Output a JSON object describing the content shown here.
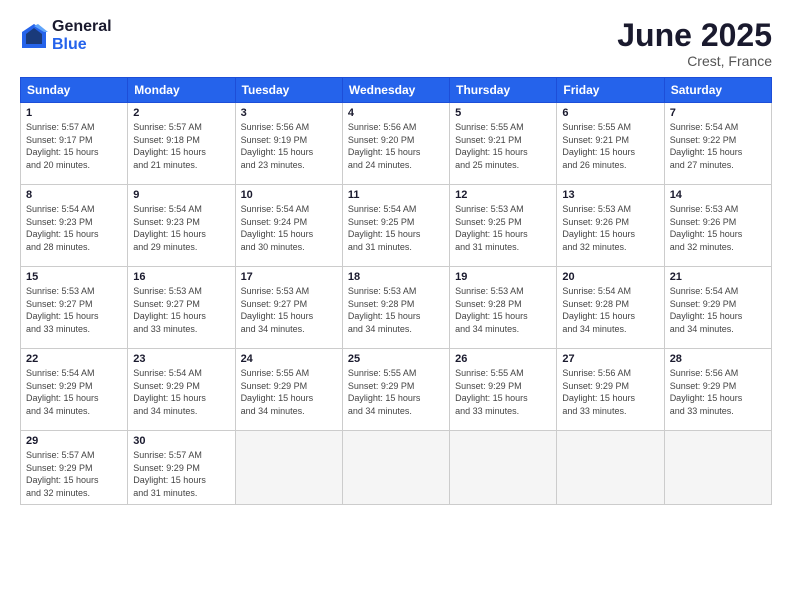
{
  "logo": {
    "general": "General",
    "blue": "Blue"
  },
  "title": "June 2025",
  "location": "Crest, France",
  "headers": [
    "Sunday",
    "Monday",
    "Tuesday",
    "Wednesday",
    "Thursday",
    "Friday",
    "Saturday"
  ],
  "weeks": [
    [
      {
        "day": "1",
        "info": "Sunrise: 5:57 AM\nSunset: 9:17 PM\nDaylight: 15 hours\nand 20 minutes."
      },
      {
        "day": "2",
        "info": "Sunrise: 5:57 AM\nSunset: 9:18 PM\nDaylight: 15 hours\nand 21 minutes."
      },
      {
        "day": "3",
        "info": "Sunrise: 5:56 AM\nSunset: 9:19 PM\nDaylight: 15 hours\nand 23 minutes."
      },
      {
        "day": "4",
        "info": "Sunrise: 5:56 AM\nSunset: 9:20 PM\nDaylight: 15 hours\nand 24 minutes."
      },
      {
        "day": "5",
        "info": "Sunrise: 5:55 AM\nSunset: 9:21 PM\nDaylight: 15 hours\nand 25 minutes."
      },
      {
        "day": "6",
        "info": "Sunrise: 5:55 AM\nSunset: 9:21 PM\nDaylight: 15 hours\nand 26 minutes."
      },
      {
        "day": "7",
        "info": "Sunrise: 5:54 AM\nSunset: 9:22 PM\nDaylight: 15 hours\nand 27 minutes."
      }
    ],
    [
      {
        "day": "8",
        "info": "Sunrise: 5:54 AM\nSunset: 9:23 PM\nDaylight: 15 hours\nand 28 minutes."
      },
      {
        "day": "9",
        "info": "Sunrise: 5:54 AM\nSunset: 9:23 PM\nDaylight: 15 hours\nand 29 minutes."
      },
      {
        "day": "10",
        "info": "Sunrise: 5:54 AM\nSunset: 9:24 PM\nDaylight: 15 hours\nand 30 minutes."
      },
      {
        "day": "11",
        "info": "Sunrise: 5:54 AM\nSunset: 9:25 PM\nDaylight: 15 hours\nand 31 minutes."
      },
      {
        "day": "12",
        "info": "Sunrise: 5:53 AM\nSunset: 9:25 PM\nDaylight: 15 hours\nand 31 minutes."
      },
      {
        "day": "13",
        "info": "Sunrise: 5:53 AM\nSunset: 9:26 PM\nDaylight: 15 hours\nand 32 minutes."
      },
      {
        "day": "14",
        "info": "Sunrise: 5:53 AM\nSunset: 9:26 PM\nDaylight: 15 hours\nand 32 minutes."
      }
    ],
    [
      {
        "day": "15",
        "info": "Sunrise: 5:53 AM\nSunset: 9:27 PM\nDaylight: 15 hours\nand 33 minutes."
      },
      {
        "day": "16",
        "info": "Sunrise: 5:53 AM\nSunset: 9:27 PM\nDaylight: 15 hours\nand 33 minutes."
      },
      {
        "day": "17",
        "info": "Sunrise: 5:53 AM\nSunset: 9:27 PM\nDaylight: 15 hours\nand 34 minutes."
      },
      {
        "day": "18",
        "info": "Sunrise: 5:53 AM\nSunset: 9:28 PM\nDaylight: 15 hours\nand 34 minutes."
      },
      {
        "day": "19",
        "info": "Sunrise: 5:53 AM\nSunset: 9:28 PM\nDaylight: 15 hours\nand 34 minutes."
      },
      {
        "day": "20",
        "info": "Sunrise: 5:54 AM\nSunset: 9:28 PM\nDaylight: 15 hours\nand 34 minutes."
      },
      {
        "day": "21",
        "info": "Sunrise: 5:54 AM\nSunset: 9:29 PM\nDaylight: 15 hours\nand 34 minutes."
      }
    ],
    [
      {
        "day": "22",
        "info": "Sunrise: 5:54 AM\nSunset: 9:29 PM\nDaylight: 15 hours\nand 34 minutes."
      },
      {
        "day": "23",
        "info": "Sunrise: 5:54 AM\nSunset: 9:29 PM\nDaylight: 15 hours\nand 34 minutes."
      },
      {
        "day": "24",
        "info": "Sunrise: 5:55 AM\nSunset: 9:29 PM\nDaylight: 15 hours\nand 34 minutes."
      },
      {
        "day": "25",
        "info": "Sunrise: 5:55 AM\nSunset: 9:29 PM\nDaylight: 15 hours\nand 34 minutes."
      },
      {
        "day": "26",
        "info": "Sunrise: 5:55 AM\nSunset: 9:29 PM\nDaylight: 15 hours\nand 33 minutes."
      },
      {
        "day": "27",
        "info": "Sunrise: 5:56 AM\nSunset: 9:29 PM\nDaylight: 15 hours\nand 33 minutes."
      },
      {
        "day": "28",
        "info": "Sunrise: 5:56 AM\nSunset: 9:29 PM\nDaylight: 15 hours\nand 33 minutes."
      }
    ],
    [
      {
        "day": "29",
        "info": "Sunrise: 5:57 AM\nSunset: 9:29 PM\nDaylight: 15 hours\nand 32 minutes."
      },
      {
        "day": "30",
        "info": "Sunrise: 5:57 AM\nSunset: 9:29 PM\nDaylight: 15 hours\nand 31 minutes."
      },
      {
        "day": "",
        "info": ""
      },
      {
        "day": "",
        "info": ""
      },
      {
        "day": "",
        "info": ""
      },
      {
        "day": "",
        "info": ""
      },
      {
        "day": "",
        "info": ""
      }
    ]
  ]
}
